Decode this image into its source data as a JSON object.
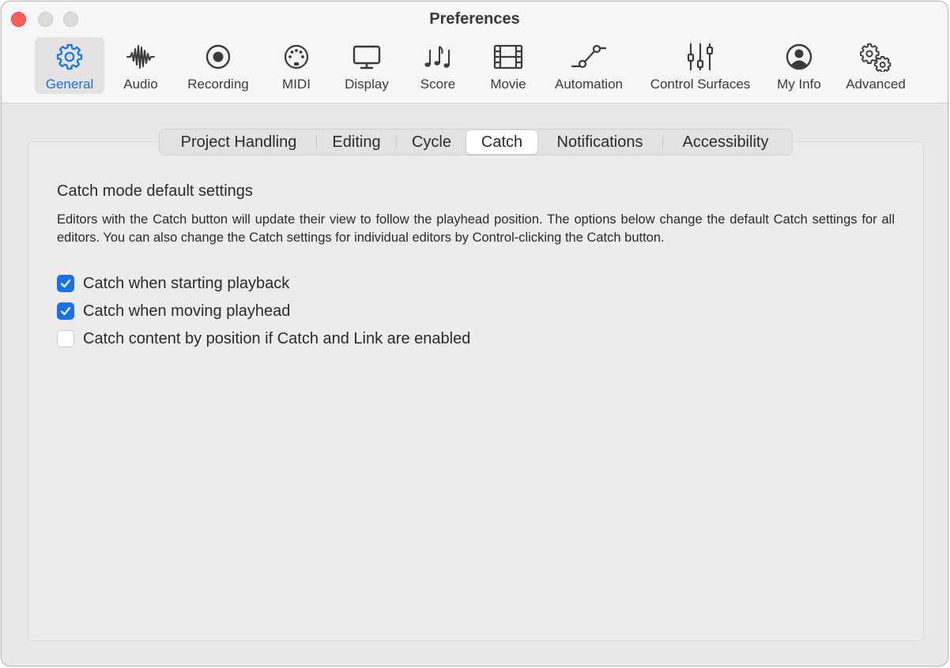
{
  "window": {
    "title": "Preferences"
  },
  "toolbar": {
    "items": [
      {
        "label": "General",
        "icon": "gear-icon",
        "selected": true
      },
      {
        "label": "Audio",
        "icon": "waveform-icon"
      },
      {
        "label": "Recording",
        "icon": "record-icon"
      },
      {
        "label": "MIDI",
        "icon": "midi-connector-icon"
      },
      {
        "label": "Display",
        "icon": "monitor-icon"
      },
      {
        "label": "Score",
        "icon": "music-notes-icon"
      },
      {
        "label": "Movie",
        "icon": "film-icon"
      },
      {
        "label": "Automation",
        "icon": "automation-curve-icon"
      },
      {
        "label": "Control Surfaces",
        "icon": "faders-icon"
      },
      {
        "label": "My Info",
        "icon": "person-circle-icon"
      },
      {
        "label": "Advanced",
        "icon": "gears-icon"
      }
    ]
  },
  "tabs": [
    {
      "label": "Project Handling"
    },
    {
      "label": "Editing"
    },
    {
      "label": "Cycle"
    },
    {
      "label": "Catch",
      "active": true
    },
    {
      "label": "Notifications"
    },
    {
      "label": "Accessibility"
    }
  ],
  "catch": {
    "section_title": "Catch mode default settings",
    "description": "Editors with the Catch button will update their view to follow the playhead position. The options below change the default Catch settings for all editors. You can also change the Catch settings for individual editors by Control-clicking the Catch button.",
    "options": [
      {
        "label": "Catch when starting playback",
        "checked": true
      },
      {
        "label": "Catch when moving playhead",
        "checked": true
      },
      {
        "label": "Catch content by position if Catch and Link are enabled",
        "checked": false
      }
    ]
  },
  "colors": {
    "accent": "#1a72e8",
    "close": "#ff5f57"
  }
}
